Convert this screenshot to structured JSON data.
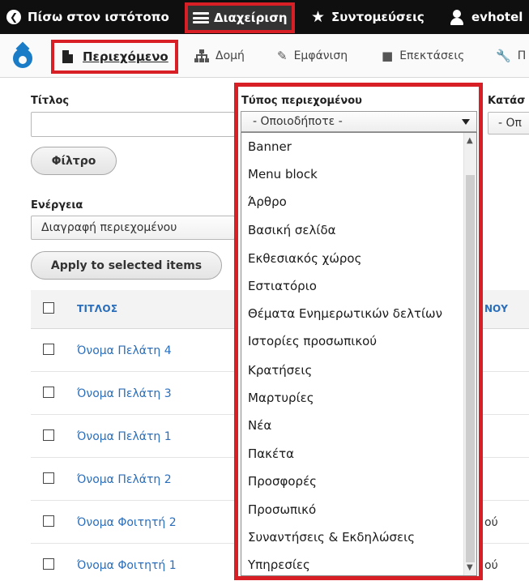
{
  "toolbar": {
    "back_label": "Πίσω στον ιστότοπο",
    "manage_label": "Διαχείριση",
    "shortcuts_label": "Συντομεύσεις",
    "user_label": "evhotel"
  },
  "tray": {
    "content_label": "Περιεχόμενο",
    "structure_label": "Δομή",
    "appearance_label": "Εμφάνιση",
    "extensions_label": "Επεκτάσεις",
    "more_label": "Π"
  },
  "filters": {
    "title_label": "Τίτλος",
    "title_value": "",
    "type_label": "Τύπος περιεχομένου",
    "type_selected": "- Οποιοδήποτε -",
    "status_label": "Κατάσ",
    "status_selected": "- Οπ",
    "filter_button": "Φίλτρο"
  },
  "bulk": {
    "action_label": "Ενέργεια",
    "action_selected": "Διαγραφή περιεχομένου",
    "apply_button": "Apply to selected items"
  },
  "table": {
    "col_title": "ΤΙΤΛΟΣ",
    "col_right_fragment": "ΝΟΥ",
    "rows": [
      {
        "title": "Όνομα Πελάτη 4",
        "right": ""
      },
      {
        "title": "Όνομα Πελάτη 3",
        "right": ""
      },
      {
        "title": "Όνομα Πελάτη 1",
        "right": ""
      },
      {
        "title": "Όνομα Πελάτη 2",
        "right": ""
      },
      {
        "title": "Όνομα Φοιτητή 2",
        "right": "ού"
      },
      {
        "title": "Όνομα Φοιτητή 1",
        "right": "ού"
      }
    ]
  },
  "type_options": [
    "Banner",
    "Menu block",
    "Άρθρο",
    "Βασική σελίδα",
    "Εκθεσιακός χώρος",
    "Εστιατόριο",
    "Θέματα Ενημερωτικών δελτίων",
    "Ιστορίες προσωπικού",
    "Κρατήσεις",
    "Μαρτυρίες",
    "Νέα",
    "Πακέτα",
    "Προσφορές",
    "Προσωπικό",
    "Συναντήσεις & Εκδηλώσεις",
    "Υπηρεσίες"
  ],
  "colors": {
    "highlight": "#d81f26",
    "link": "#2a6ebb",
    "toolbar_bg": "#0f0f0f"
  }
}
